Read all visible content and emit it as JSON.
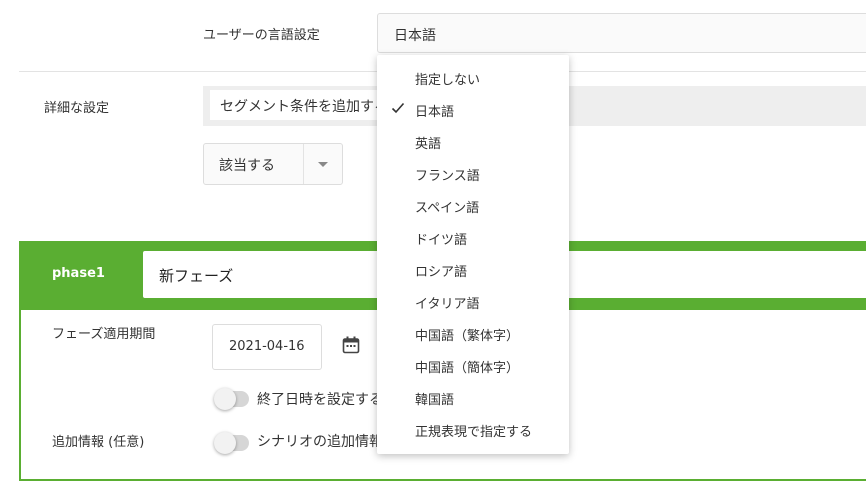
{
  "language_setting": {
    "label": "ユーザーの言語設定",
    "selected": "日本語",
    "options": [
      "指定しない",
      "日本語",
      "英語",
      "フランス語",
      "スペイン語",
      "ドイツ語",
      "ロシア語",
      "イタリア語",
      "中国語（繁体字）",
      "中国語（簡体字）",
      "韓国語",
      "正規表現で指定する"
    ],
    "checked_index": 1
  },
  "segment": {
    "label": "詳細な設定",
    "add_condition": "セグメント条件を追加する",
    "match_value": "該当する"
  },
  "phase": {
    "name": "phase1",
    "title_value": "新フェーズ",
    "period_label": "フェーズ適用期間",
    "start_date": "2021-04-16",
    "end_toggle_label": "終了日時を設定する",
    "additional_label": "追加情報 (任意)",
    "additional_toggle_label": "シナリオの追加情報"
  },
  "colors": {
    "accent": "#5aae32"
  }
}
